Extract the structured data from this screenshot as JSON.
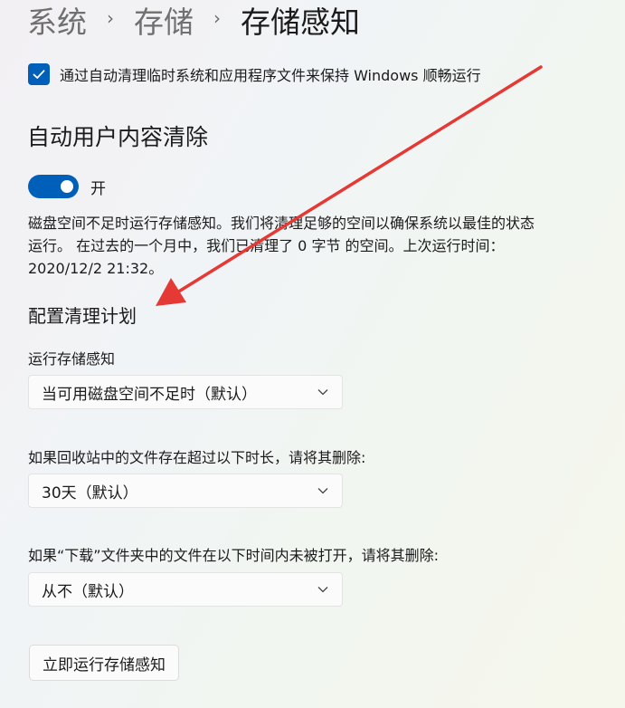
{
  "breadcrumb": {
    "items": [
      "系统",
      "存储",
      "存储感知"
    ],
    "separator": "›"
  },
  "checkbox": {
    "label": "通过自动清理临时系统和应用程序文件来保持 Windows 顺畅运行",
    "checked": true
  },
  "section": {
    "title": "自动用户内容清除",
    "toggle": {
      "label": "开",
      "on": true
    },
    "description": "磁盘空间不足时运行存储感知。我们将清理足够的空间以确保系统以最佳的状态运行。 在过去的一个月中，我们已清理了 0 字节 的空间。上次运行时间：2020/12/2 21:32。"
  },
  "schedule": {
    "title": "配置清理计划",
    "run_label": "运行存储感知",
    "run_value": "当可用磁盘空间不足时（默认）",
    "recycle_label": "如果回收站中的文件存在超过以下时长，请将其删除:",
    "recycle_value": "30天（默认）",
    "downloads_label": "如果“下载”文件夹中的文件在以下时间内未被打开，请将其删除:",
    "downloads_value": "从不（默认）",
    "run_now_label": "立即运行存储感知"
  },
  "colors": {
    "accent": "#005fb8",
    "annotation_arrow": "#e53935"
  }
}
